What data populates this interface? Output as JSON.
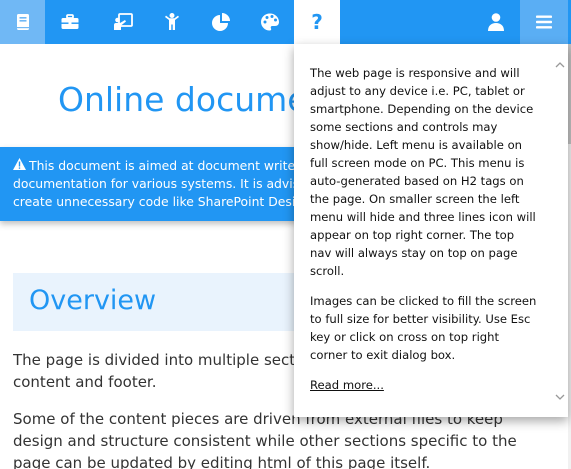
{
  "nav": {
    "icons": [
      "book-icon",
      "briefcase-icon",
      "presentation-icon",
      "person-icon",
      "pie-chart-icon",
      "palette-icon",
      "help-icon",
      "user-icon",
      "menu-icon"
    ],
    "help_label": "?",
    "colors": {
      "nav_bg": "#2196F3",
      "active_tab": "#70b8f5",
      "menu_tab": "#5aaef4"
    }
  },
  "page": {
    "title": "Online docume",
    "alert_lines": [
      "This document is aimed at document writer",
      "documentation for various systems. It is advis",
      "create unnecessary code like SharePoint Desig"
    ],
    "overview_heading": "Overview",
    "paragraphs": [
      [
        "The page is divided into multiple sect",
        "content and footer."
      ],
      [
        "Some of the content pieces are driven from external files to keep",
        "design and structure consistent while other sections specific to the",
        "page can be updated by editing html of this page itself."
      ]
    ]
  },
  "help_dropdown": {
    "paragraph1": "The web page is responsive and will adjust to any device i.e. PC, tablet or smartphone. Depending on the device some sections and controls may show/hide. Left menu is available on full screen mode on PC. This menu is auto-generated based on H2 tags on the page. On smaller screen the left menu will hide and three lines icon will appear on top right corner. The top nav will always stay on top on page scroll.",
    "paragraph2": "Images can be clicked to fill the screen to full size for better visibility. Use Esc key or click on cross on top right corner to exit dialog box.",
    "read_more": "Read more..."
  }
}
